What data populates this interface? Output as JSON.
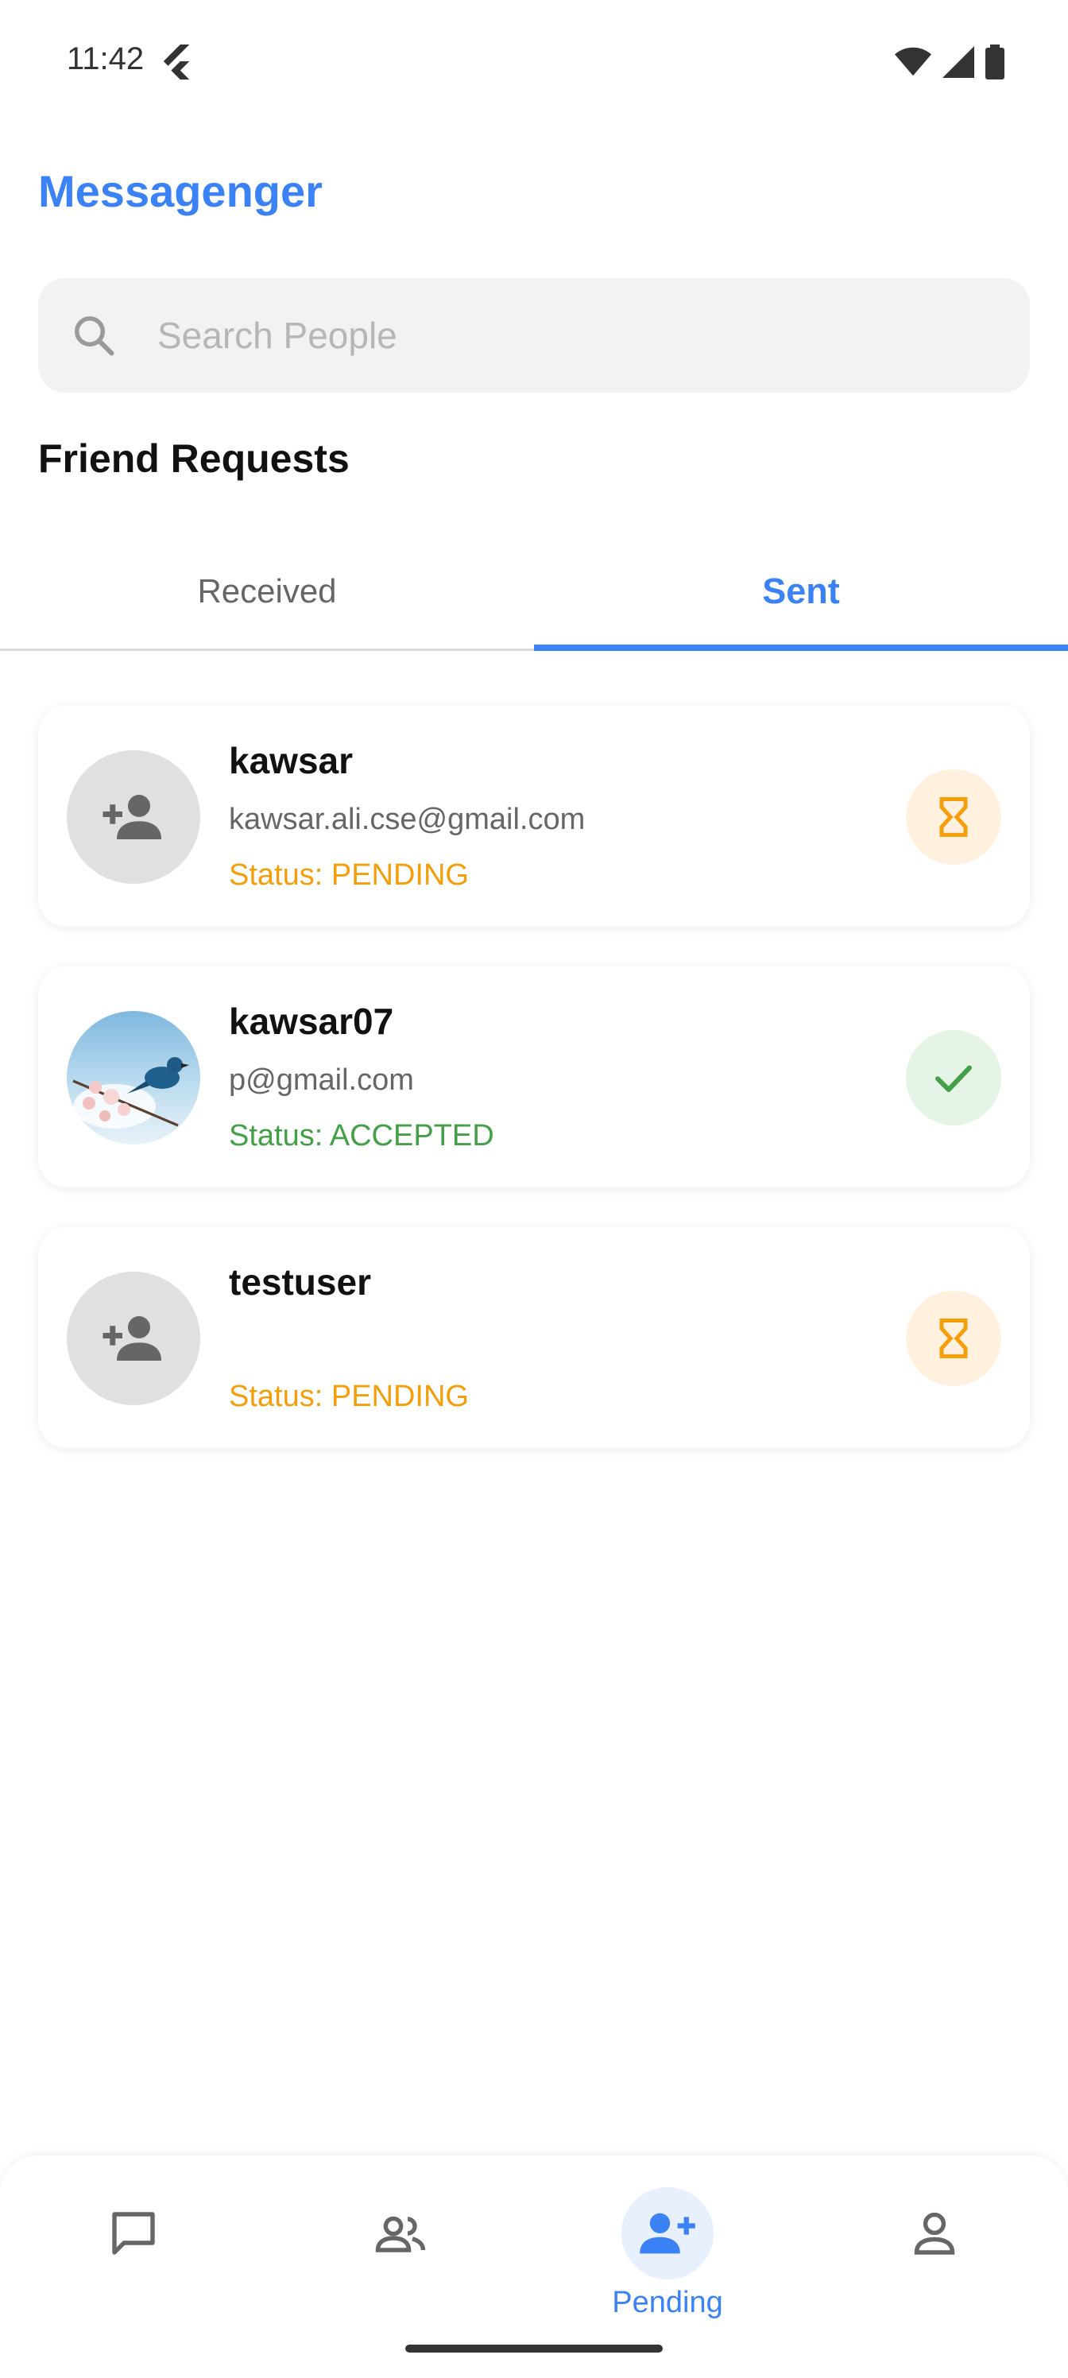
{
  "status_bar": {
    "time": "11:42"
  },
  "app": {
    "title": "Messagenger"
  },
  "search": {
    "placeholder": "Search People"
  },
  "section": {
    "title": "Friend Requests"
  },
  "tabs": [
    {
      "label": "Received",
      "active": false
    },
    {
      "label": "Sent",
      "active": true
    }
  ],
  "requests": [
    {
      "name": "kawsar",
      "email": "kawsar.ali.cse@gmail.com",
      "status": "Status: PENDING",
      "state": "pending"
    },
    {
      "name": "kawsar07",
      "email": "p@gmail.com",
      "status": "Status: ACCEPTED",
      "state": "accepted"
    },
    {
      "name": "testuser",
      "email": "",
      "status": "Status: PENDING",
      "state": "pending"
    }
  ],
  "bottom_nav": {
    "items": [
      {
        "icon": "chat-icon"
      },
      {
        "icon": "people-icon"
      },
      {
        "icon": "person-add-icon",
        "label": "Pending",
        "active": true
      },
      {
        "icon": "profile-icon"
      }
    ]
  },
  "colors": {
    "accent": "#3b82f6",
    "pending": "#f59e0b",
    "accepted": "#43a047"
  }
}
